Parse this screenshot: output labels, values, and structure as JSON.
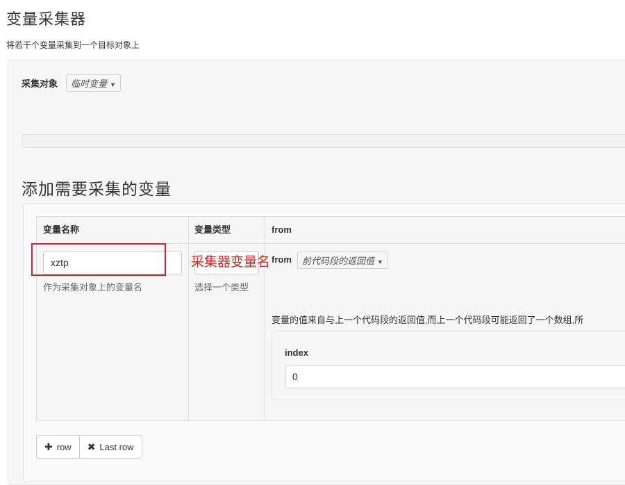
{
  "header": {
    "title": "变量采集器",
    "description": "将若干个变量采集到一个目标对象上"
  },
  "target": {
    "label": "采集对象",
    "selected": "临时变量"
  },
  "section": {
    "title": "添加需要采集的变量"
  },
  "table": {
    "columns": [
      "变量名称",
      "变量类型",
      "from"
    ],
    "row": {
      "varname_value": "xztp",
      "varname_help": "作为采集对象上的变量名",
      "type_value": "",
      "type_help": "选择一个类型",
      "from_label": "from",
      "from_selected": "前代码段的返回值",
      "from_description": "变量的值来自与上一个代码段的返回值,而上一个代码段可能返回了一个数组,所",
      "index_label": "index",
      "index_value": "0"
    }
  },
  "annotation": {
    "text": "采集器变量名",
    "color": "#e02020"
  },
  "buttons": {
    "add_row": "row",
    "remove_last": "Last row"
  },
  "icons": {
    "dropdown_caret": "caret-down-icon",
    "add": "plus-icon",
    "remove": "times-icon"
  }
}
